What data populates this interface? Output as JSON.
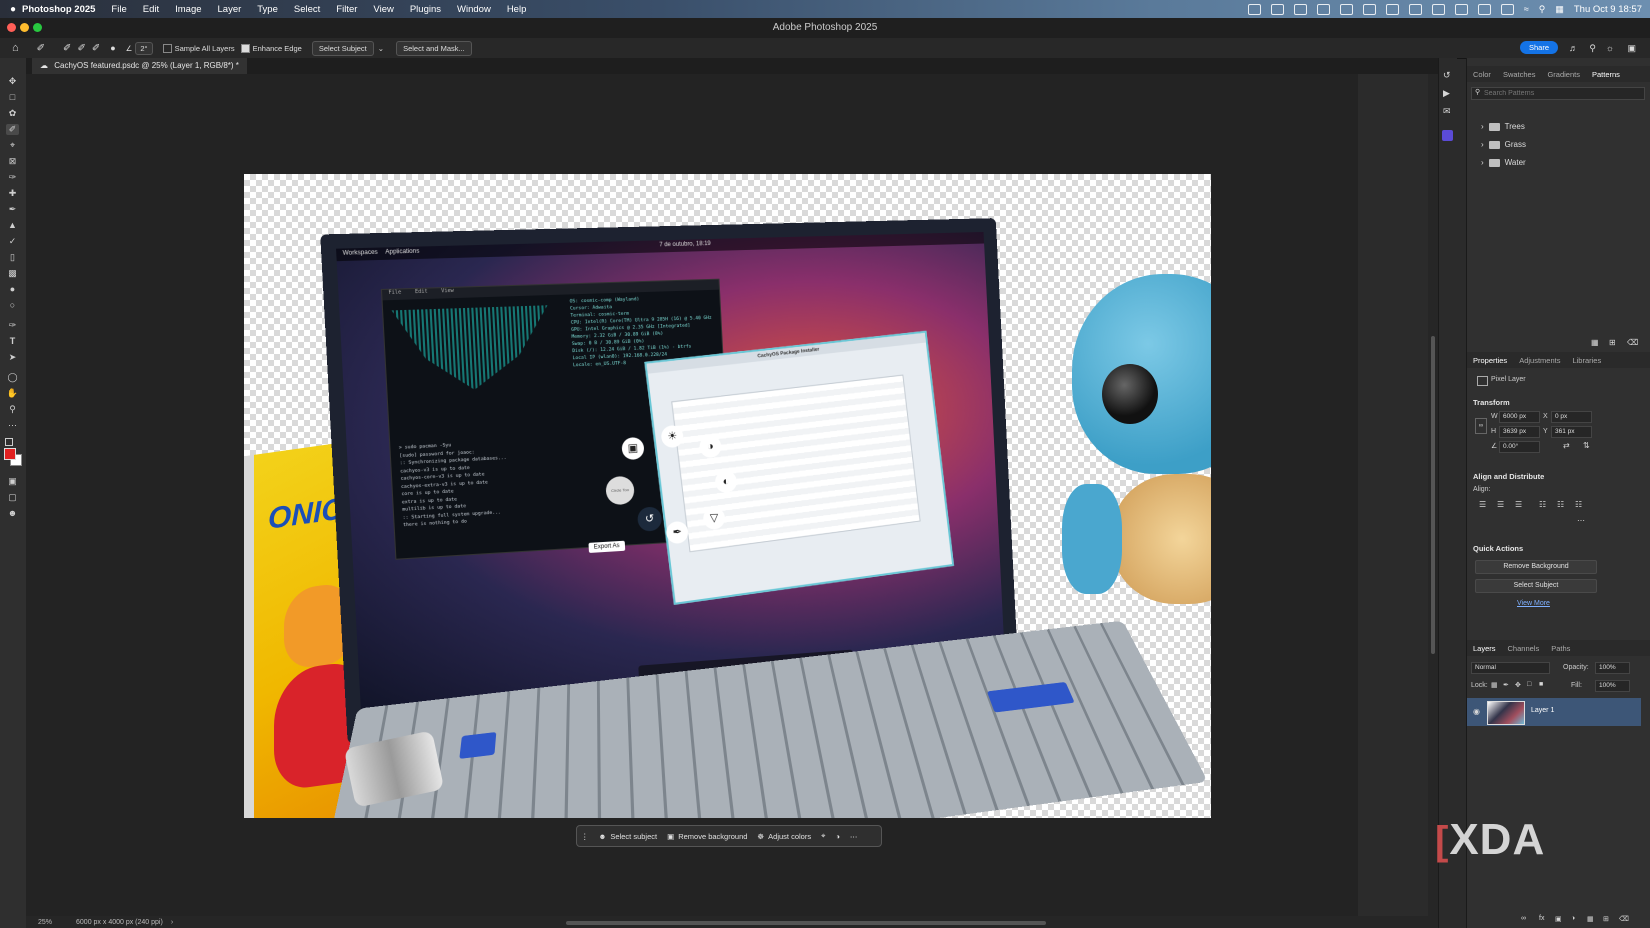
{
  "menubar": {
    "app": "Photoshop 2025",
    "items": [
      "File",
      "Edit",
      "Image",
      "Layer",
      "Type",
      "Select",
      "Filter",
      "View",
      "Plugins",
      "Window",
      "Help"
    ],
    "clock": "Thu Oct 9  18:57"
  },
  "window": {
    "title": "Adobe Photoshop 2025"
  },
  "options": {
    "brush_size": "2°",
    "sample_all_layers": "Sample All Layers",
    "enhance_edge": "Enhance Edge",
    "select_subject": "Select Subject",
    "select_and_mask": "Select and Mask...",
    "share": "Share"
  },
  "document": {
    "tab": "CachyOS featured.psdc @ 25% (Layer 1, RGB/8*) *"
  },
  "taskbar": {
    "select_subject": "Select subject",
    "remove_background": "Remove background",
    "adjust_colors": "Adjust colors"
  },
  "status": {
    "zoom": "25%",
    "size": "6000 px x 4000 px (240 ppi)"
  },
  "panels": {
    "top_tabs": [
      "Color",
      "Swatches",
      "Gradients",
      "Patterns"
    ],
    "search_placeholder": "Search Patterns",
    "patterns": [
      "Trees",
      "Grass",
      "Water"
    ],
    "props_tabs": [
      "Properties",
      "Adjustments",
      "Libraries"
    ],
    "pixel_layer": "Pixel Layer",
    "transform": "Transform",
    "w_label": "W",
    "w": "6000 px",
    "x_label": "X",
    "x": "0 px",
    "h_label": "H",
    "h": "3639 px",
    "y_label": "Y",
    "y": "361 px",
    "angle": "0.00°",
    "align_distribute": "Align and Distribute",
    "align": "Align:",
    "quick_actions": "Quick Actions",
    "remove_background": "Remove Background",
    "select_subject": "Select Subject",
    "view_more": "View More",
    "layers_tabs": [
      "Layers",
      "Channels",
      "Paths"
    ],
    "blend_mode": "Normal",
    "opacity_label": "Opacity:",
    "opacity": "100%",
    "lock_label": "Lock:",
    "fill_label": "Fill:",
    "fill": "100%",
    "layer_name": "Layer 1"
  },
  "photo": {
    "date": "7 de outubro, 18:19",
    "workspaces": "Workspaces",
    "applications": "Applications",
    "terminal_menu": [
      "File",
      "Edit",
      "View"
    ],
    "terminal_info": [
      "OS: cosmic-comp (Wayland)",
      "Cursor: Adwaita",
      "Terminal: cosmic-term",
      "CPU: Intel(R) Core(TM) Ultra 9 285H (16) @ 5.40 GHz",
      "GPU: Intel Graphics @ 2.35 GHz [Integrated]",
      "Memory: 2.32 GiB / 30.89 GiB (8%)",
      "Swap: 0 B / 30.89 GiB (0%)",
      "Disk (/): 12.24 GiB / 1.82 TiB (1%) - btrfs",
      "Local IP (wlan0): 192.168.0.228/24",
      "Locale: en_US.UTF-8"
    ],
    "terminal_log": [
      "> sudo pacman -Syu",
      "[sudo] password for joaoc:",
      ":: Synchronizing package databases...",
      "cachyos-v3 is up to date",
      "cachyos-core-v3 is up to date",
      "cachyos-extra-v3 is up to date",
      "core is up to date",
      "extra is up to date",
      "multilib is up to date",
      ":: Starting full system upgrade...",
      "there is nothing to do"
    ],
    "installer_title": "CachyOS Package Installer",
    "export_as": "Export As",
    "circle_tool": "Circle Too",
    "box_art": "ONIC"
  },
  "watermark": "XDA",
  "colors": {
    "accent": "#1473e6",
    "foreground_swatch": "#e02020",
    "layer_selected": "#3d5677"
  }
}
